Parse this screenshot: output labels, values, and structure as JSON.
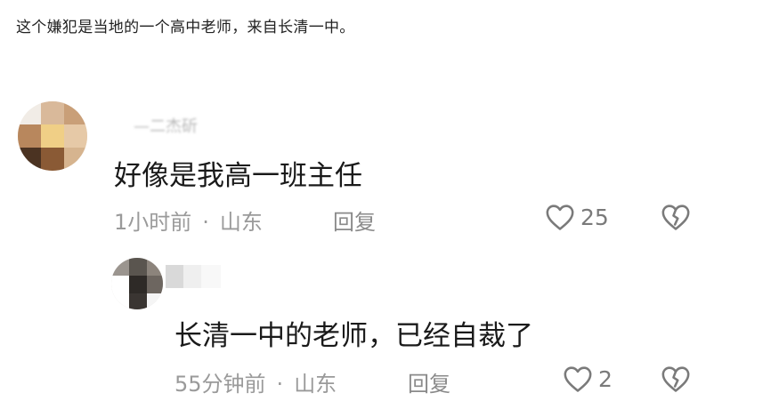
{
  "article": {
    "caption": "这个嫌犯是当地的一个高中老师，来自长清一中。"
  },
  "comments": [
    {
      "text": "好像是我高一班主任",
      "time": "1小时前",
      "location": "山东",
      "reply_label": "回复",
      "likes": "25",
      "username": "—二杰斫"
    },
    {
      "text": "长清一中的老师，已经自裁了",
      "time": "55分钟前",
      "location": "山东",
      "reply_label": "回复",
      "likes": "2"
    }
  ],
  "separator": "·",
  "icons": {
    "like": "heart-outline-icon",
    "dislike": "broken-heart-icon"
  },
  "colors": {
    "text": "#1a1a1a",
    "meta": "#9a9a9a",
    "icon": "#7a7a7a"
  }
}
